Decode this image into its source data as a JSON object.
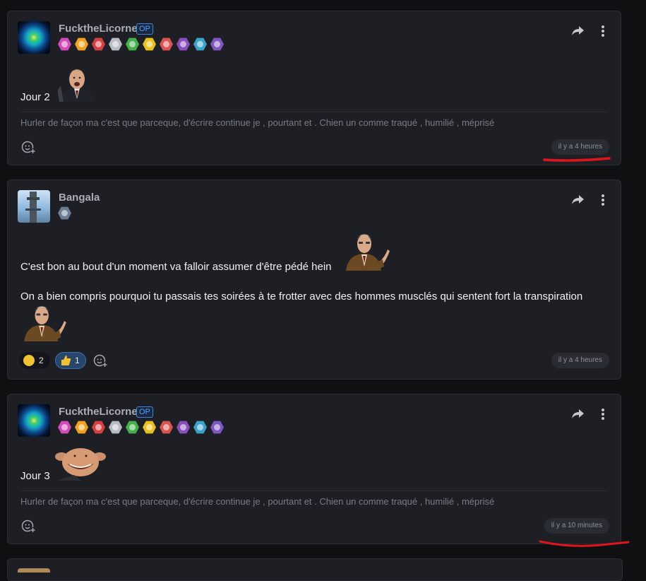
{
  "posts": [
    {
      "username": "FucktheLicorne",
      "op_label": "OP",
      "text_prefix": "Jour 2",
      "signature": "Hurler de façon ma c'est que parceque, d'écrire continue je , pourtant et . Chien un comme traqué , humilié , méprisé",
      "timestamp": "il y a 4 heures"
    },
    {
      "username": "Bangala",
      "line1": "C'est bon au bout d'un moment va falloir assumer d'être pédé hein",
      "line2": "On a bien compris pourquoi tu passais tes soirées à te frotter avec des hommes musclés qui sentent fort la transpiration",
      "reactions": [
        {
          "emoji": "laugh-emoji",
          "count": "2"
        },
        {
          "emoji": "thumbs-up-emoji",
          "count": "1"
        }
      ],
      "timestamp": "il y a 4 heures"
    },
    {
      "username": "FucktheLicorne",
      "op_label": "OP",
      "text_prefix": "Jour 3",
      "signature": "Hurler de façon ma c'est que parceque, d'écrire continue je , pourtant et . Chien un comme traqué , humilié , méprisé",
      "timestamp": "il y a 10 minutes"
    }
  ],
  "badge_colors": [
    "#d24bb8",
    "#f0a21e",
    "#d64040",
    "#b8bcc4",
    "#43b04a",
    "#e8c21a",
    "#d9534f",
    "#8a4fbf",
    "#3aa3c9",
    "#7e57c2"
  ],
  "colors": {
    "accent": "#4aa3ff",
    "annotation_red": "#e0141c"
  }
}
